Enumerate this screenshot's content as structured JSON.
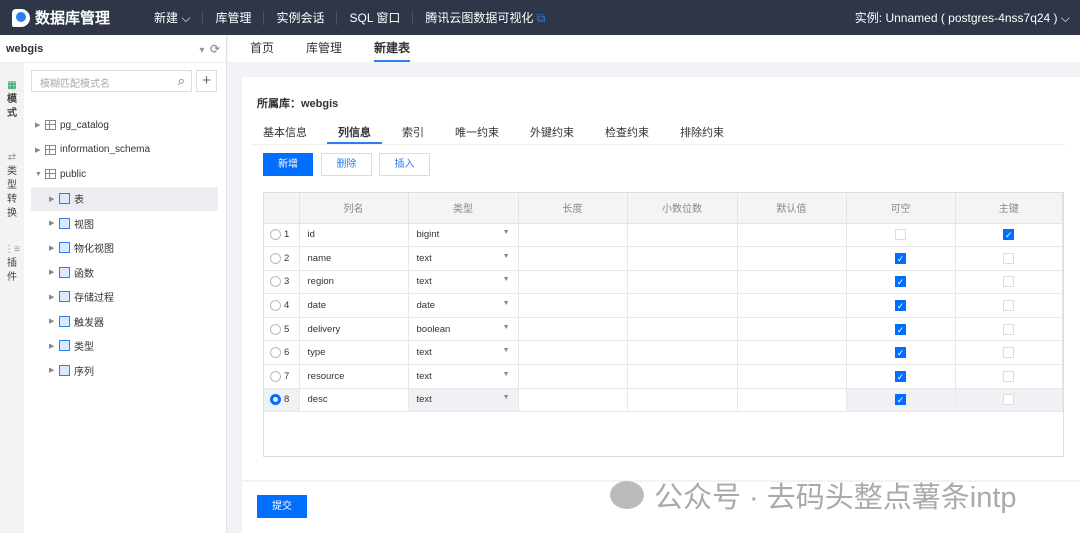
{
  "header": {
    "app_title": "数据库管理",
    "nav": [
      "新建",
      "库管理",
      "实例会话",
      "SQL 窗口",
      "腾讯云图数据可视化"
    ],
    "instance": "实例: Unnamed ( postgres-4nss7q24 )"
  },
  "sidebar": {
    "database": "webgis",
    "rail": [
      "模式",
      "类型转换",
      "插件"
    ],
    "search_placeholder": "模糊匹配模式名",
    "plus": "+",
    "tree": [
      {
        "label": "pg_catalog",
        "level": 0,
        "icon": "grid",
        "open": false
      },
      {
        "label": "information_schema",
        "level": 0,
        "icon": "grid",
        "open": false
      },
      {
        "label": "public",
        "level": 0,
        "icon": "grid",
        "open": true
      },
      {
        "label": "表",
        "level": 1,
        "icon": "list",
        "selected": true
      },
      {
        "label": "视图",
        "level": 1,
        "icon": "list"
      },
      {
        "label": "物化视图",
        "level": 1,
        "icon": "list"
      },
      {
        "label": "函数",
        "level": 1,
        "icon": "list"
      },
      {
        "label": "存储过程",
        "level": 1,
        "icon": "list"
      },
      {
        "label": "触发器",
        "level": 1,
        "icon": "list"
      },
      {
        "label": "类型",
        "level": 1,
        "icon": "list"
      },
      {
        "label": "序列",
        "level": 1,
        "icon": "list"
      }
    ]
  },
  "tabs": [
    "首页",
    "库管理",
    "新建表"
  ],
  "active_tab": 2,
  "form": {
    "title": "所属库：webgis",
    "subtabs": [
      "基本信息",
      "列信息",
      "索引",
      "唯一约束",
      "外键约束",
      "检查约束",
      "排除约束"
    ],
    "active_subtab": 1,
    "buttons": {
      "add": "新增",
      "delete": "删除",
      "insert": "插入"
    },
    "columns": [
      "",
      "列名",
      "类型",
      "长度",
      "小数位数",
      "默认值",
      "可空",
      "主键"
    ],
    "rows": [
      {
        "n": "1",
        "name": "id",
        "type": "bigint",
        "nullable": false,
        "pk": true
      },
      {
        "n": "2",
        "name": "name",
        "type": "text",
        "nullable": true,
        "pk": false
      },
      {
        "n": "3",
        "name": "region",
        "type": "text",
        "nullable": true,
        "pk": false
      },
      {
        "n": "4",
        "name": "date",
        "type": "date",
        "nullable": true,
        "pk": false
      },
      {
        "n": "5",
        "name": "delivery",
        "type": "boolean",
        "nullable": true,
        "pk": false
      },
      {
        "n": "6",
        "name": "type",
        "type": "text",
        "nullable": true,
        "pk": false
      },
      {
        "n": "7",
        "name": "resource",
        "type": "text",
        "nullable": true,
        "pk": false
      },
      {
        "n": "8",
        "name": "desc",
        "type": "text",
        "nullable": true,
        "pk": false,
        "selected": true
      }
    ],
    "submit": "提交"
  },
  "watermark": "公众号 · 去码头整点薯条intp"
}
